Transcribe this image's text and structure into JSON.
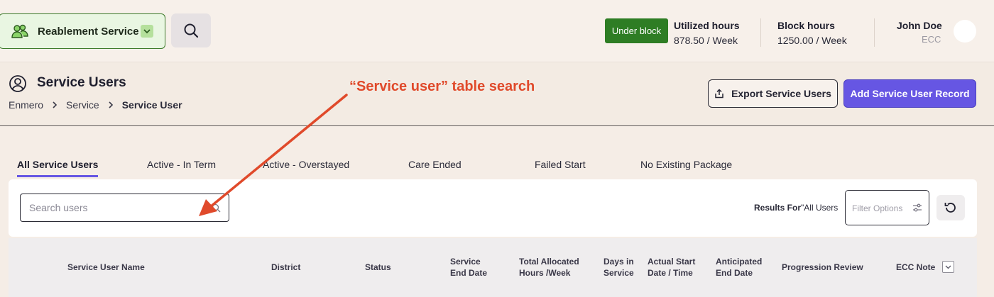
{
  "topbar": {
    "service_selector": "Reablement Service",
    "block_status": "Under block",
    "utilized": {
      "label": "Utilized hours",
      "value": "878.50 / Week"
    },
    "block": {
      "label": "Block hours",
      "value": "1250.00 / Week"
    },
    "user": {
      "name": "John Doe",
      "org": "ECC"
    }
  },
  "page": {
    "title": "Service Users",
    "breadcrumb": [
      "Enmero",
      "Service",
      "Service User"
    ],
    "export_label": "Export Service Users",
    "add_label": "Add Service User Record"
  },
  "annotation": "“Service user” table search",
  "tabs": [
    "All Service Users",
    "Active - In Term",
    "Active - Overstayed",
    "Care Ended",
    "Failed Start",
    "No Existing Package"
  ],
  "filters": {
    "search_placeholder": "Search users",
    "results_prefix": "Results For",
    "results_value": "\"All Users",
    "filter_placeholder": "Filter Options"
  },
  "table": {
    "columns": [
      [
        "Service User Name"
      ],
      [
        "District"
      ],
      [
        "Status"
      ],
      [
        "Service",
        "End Date"
      ],
      [
        "Total Allocated",
        "Hours /Week"
      ],
      [
        "Days in",
        "Service"
      ],
      [
        "Actual Start",
        "Date / Time"
      ],
      [
        "Anticipated",
        "End Date"
      ],
      [
        "Progression Review"
      ],
      [
        "ECC Note"
      ]
    ]
  },
  "icons": {
    "service": "people-icon",
    "search": "search-icon",
    "page": "user-circle-icon",
    "export": "export-icon",
    "filter": "sliders-icon",
    "reset": "refresh-icon"
  },
  "colors": {
    "accent": "#6656e3",
    "block_badge": "#2e7d24",
    "annotation": "#e04a2b"
  }
}
